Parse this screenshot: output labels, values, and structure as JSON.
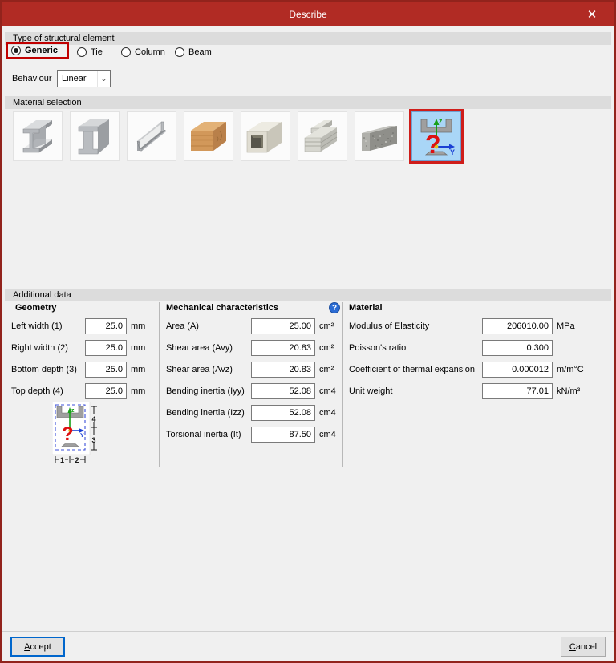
{
  "titlebar": {
    "title": "Describe",
    "close_glyph": "✕"
  },
  "colors": {
    "titlebar_red": "#b12b24",
    "border_red": "#92231c",
    "selection_red": "#c00000",
    "selected_tile_blue": "#a9d6f7",
    "focus_blue": "#0066cc"
  },
  "type_section": {
    "header": "Type of structural element",
    "options": [
      {
        "label": "Generic",
        "selected": true,
        "highlighted": true
      },
      {
        "label": "Tie",
        "selected": false
      },
      {
        "label": "Column",
        "selected": false
      },
      {
        "label": "Beam",
        "selected": false
      }
    ]
  },
  "behaviour": {
    "label": "Behaviour",
    "value": "Linear",
    "chevron": "⌄"
  },
  "material_section": {
    "header": "Material selection",
    "tiles": [
      {
        "icon": "rolled-steel-ibeam-icon",
        "selected": false
      },
      {
        "icon": "welded-steel-ibeam-icon",
        "selected": false
      },
      {
        "icon": "cold-formed-steel-icon",
        "selected": false
      },
      {
        "icon": "timber-icon",
        "selected": false
      },
      {
        "icon": "hollow-box-section-icon",
        "selected": false
      },
      {
        "icon": "aluminium-extrusion-icon",
        "selected": false
      },
      {
        "icon": "concrete-icon",
        "selected": false
      },
      {
        "icon": "generic-section-icon",
        "selected": true
      }
    ]
  },
  "additional": {
    "header": "Additional data",
    "geometry": {
      "header": "Geometry",
      "fields": [
        {
          "label": "Left width (1)",
          "value": "25.0",
          "unit": "mm"
        },
        {
          "label": "Right width (2)",
          "value": "25.0",
          "unit": "mm"
        },
        {
          "label": "Bottom depth (3)",
          "value": "25.0",
          "unit": "mm"
        },
        {
          "label": "Top depth (4)",
          "value": "25.0",
          "unit": "mm"
        }
      ],
      "diagram": {
        "z": "z",
        "y": "Y",
        "d4": "4",
        "d3": "3",
        "d1": "1",
        "d2": "2",
        "q": "?"
      }
    },
    "mechanical": {
      "header": "Mechanical characteristics",
      "help_glyph": "?",
      "fields": [
        {
          "label": "Area (A)",
          "value": "25.00",
          "unit": "cm²"
        },
        {
          "label": "Shear area (Avy)",
          "value": "20.83",
          "unit": "cm²"
        },
        {
          "label": "Shear area (Avz)",
          "value": "20.83",
          "unit": "cm²"
        },
        {
          "label": "Bending inertia (Iyy)",
          "value": "52.08",
          "unit": "cm4"
        },
        {
          "label": "Bending inertia (Izz)",
          "value": "52.08",
          "unit": "cm4"
        },
        {
          "label": "Torsional inertia (It)",
          "value": "87.50",
          "unit": "cm4"
        }
      ]
    },
    "material": {
      "header": "Material",
      "fields": [
        {
          "label": "Modulus of Elasticity",
          "value": "206010.00",
          "unit": "MPa"
        },
        {
          "label": "Poisson's ratio",
          "value": "0.300",
          "unit": ""
        },
        {
          "label": "Coefficient of thermal expansion",
          "value": "0.000012",
          "unit": "m/m°C"
        },
        {
          "label": "Unit weight",
          "value": "77.01",
          "unit": "kN/m³"
        }
      ]
    }
  },
  "footer": {
    "accept": "Accept",
    "cancel": "Cancel"
  }
}
